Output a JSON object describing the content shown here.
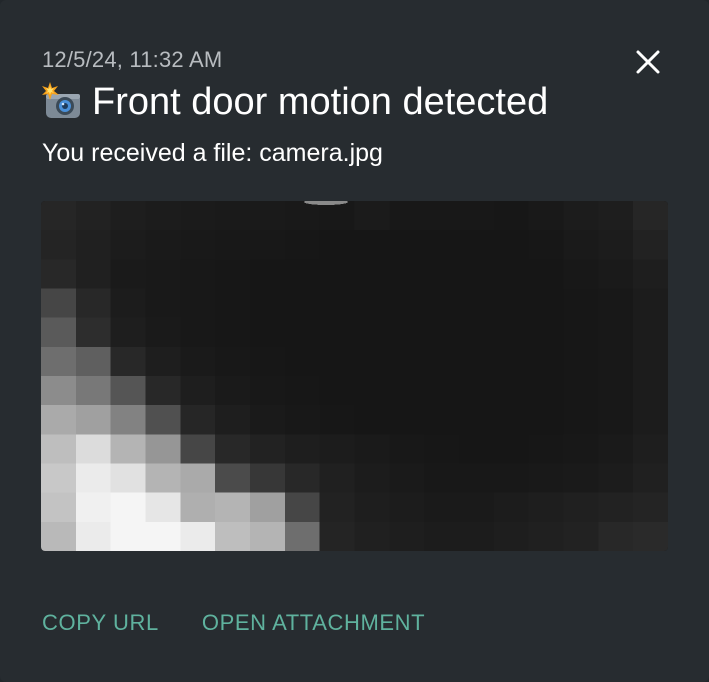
{
  "notification": {
    "timestamp": "12/5/24, 11:32 AM",
    "title": "Front door motion detected",
    "title_icon": "camera-flash-icon",
    "message": "You received a file: camera.jpg",
    "close_icon": "close-icon",
    "attachment_image": "camera-snapshot-pixelated",
    "actions": {
      "copy_url": "COPY URL",
      "open_attachment": "OPEN ATTACHMENT"
    }
  },
  "colors": {
    "background": "#272c30",
    "accent": "#5fb29e",
    "timestamp": "#b8bcc0",
    "text": "#ffffff"
  }
}
